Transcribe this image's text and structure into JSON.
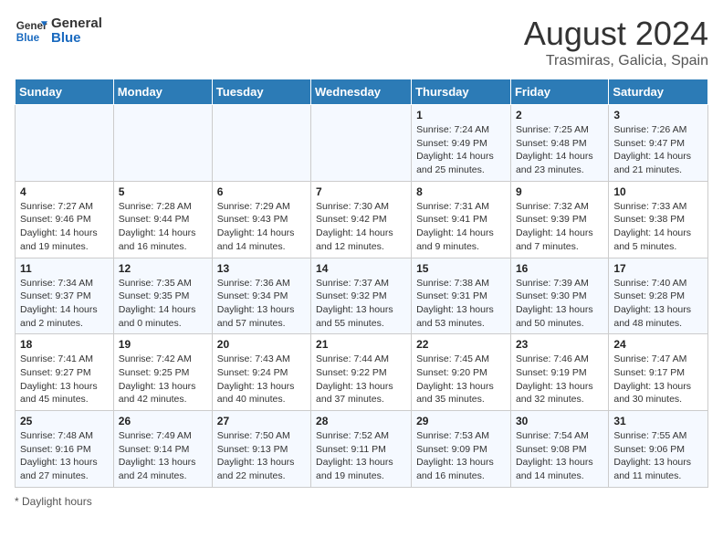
{
  "logo": {
    "line1": "General",
    "line2": "Blue"
  },
  "title": "August 2024",
  "subtitle": "Trasmiras, Galicia, Spain",
  "weekdays": [
    "Sunday",
    "Monday",
    "Tuesday",
    "Wednesday",
    "Thursday",
    "Friday",
    "Saturday"
  ],
  "weeks": [
    [
      {
        "day": "",
        "detail": ""
      },
      {
        "day": "",
        "detail": ""
      },
      {
        "day": "",
        "detail": ""
      },
      {
        "day": "",
        "detail": ""
      },
      {
        "day": "1",
        "detail": "Sunrise: 7:24 AM\nSunset: 9:49 PM\nDaylight: 14 hours and 25 minutes."
      },
      {
        "day": "2",
        "detail": "Sunrise: 7:25 AM\nSunset: 9:48 PM\nDaylight: 14 hours and 23 minutes."
      },
      {
        "day": "3",
        "detail": "Sunrise: 7:26 AM\nSunset: 9:47 PM\nDaylight: 14 hours and 21 minutes."
      }
    ],
    [
      {
        "day": "4",
        "detail": "Sunrise: 7:27 AM\nSunset: 9:46 PM\nDaylight: 14 hours and 19 minutes."
      },
      {
        "day": "5",
        "detail": "Sunrise: 7:28 AM\nSunset: 9:44 PM\nDaylight: 14 hours and 16 minutes."
      },
      {
        "day": "6",
        "detail": "Sunrise: 7:29 AM\nSunset: 9:43 PM\nDaylight: 14 hours and 14 minutes."
      },
      {
        "day": "7",
        "detail": "Sunrise: 7:30 AM\nSunset: 9:42 PM\nDaylight: 14 hours and 12 minutes."
      },
      {
        "day": "8",
        "detail": "Sunrise: 7:31 AM\nSunset: 9:41 PM\nDaylight: 14 hours and 9 minutes."
      },
      {
        "day": "9",
        "detail": "Sunrise: 7:32 AM\nSunset: 9:39 PM\nDaylight: 14 hours and 7 minutes."
      },
      {
        "day": "10",
        "detail": "Sunrise: 7:33 AM\nSunset: 9:38 PM\nDaylight: 14 hours and 5 minutes."
      }
    ],
    [
      {
        "day": "11",
        "detail": "Sunrise: 7:34 AM\nSunset: 9:37 PM\nDaylight: 14 hours and 2 minutes."
      },
      {
        "day": "12",
        "detail": "Sunrise: 7:35 AM\nSunset: 9:35 PM\nDaylight: 14 hours and 0 minutes."
      },
      {
        "day": "13",
        "detail": "Sunrise: 7:36 AM\nSunset: 9:34 PM\nDaylight: 13 hours and 57 minutes."
      },
      {
        "day": "14",
        "detail": "Sunrise: 7:37 AM\nSunset: 9:32 PM\nDaylight: 13 hours and 55 minutes."
      },
      {
        "day": "15",
        "detail": "Sunrise: 7:38 AM\nSunset: 9:31 PM\nDaylight: 13 hours and 53 minutes."
      },
      {
        "day": "16",
        "detail": "Sunrise: 7:39 AM\nSunset: 9:30 PM\nDaylight: 13 hours and 50 minutes."
      },
      {
        "day": "17",
        "detail": "Sunrise: 7:40 AM\nSunset: 9:28 PM\nDaylight: 13 hours and 48 minutes."
      }
    ],
    [
      {
        "day": "18",
        "detail": "Sunrise: 7:41 AM\nSunset: 9:27 PM\nDaylight: 13 hours and 45 minutes."
      },
      {
        "day": "19",
        "detail": "Sunrise: 7:42 AM\nSunset: 9:25 PM\nDaylight: 13 hours and 42 minutes."
      },
      {
        "day": "20",
        "detail": "Sunrise: 7:43 AM\nSunset: 9:24 PM\nDaylight: 13 hours and 40 minutes."
      },
      {
        "day": "21",
        "detail": "Sunrise: 7:44 AM\nSunset: 9:22 PM\nDaylight: 13 hours and 37 minutes."
      },
      {
        "day": "22",
        "detail": "Sunrise: 7:45 AM\nSunset: 9:20 PM\nDaylight: 13 hours and 35 minutes."
      },
      {
        "day": "23",
        "detail": "Sunrise: 7:46 AM\nSunset: 9:19 PM\nDaylight: 13 hours and 32 minutes."
      },
      {
        "day": "24",
        "detail": "Sunrise: 7:47 AM\nSunset: 9:17 PM\nDaylight: 13 hours and 30 minutes."
      }
    ],
    [
      {
        "day": "25",
        "detail": "Sunrise: 7:48 AM\nSunset: 9:16 PM\nDaylight: 13 hours and 27 minutes."
      },
      {
        "day": "26",
        "detail": "Sunrise: 7:49 AM\nSunset: 9:14 PM\nDaylight: 13 hours and 24 minutes."
      },
      {
        "day": "27",
        "detail": "Sunrise: 7:50 AM\nSunset: 9:13 PM\nDaylight: 13 hours and 22 minutes."
      },
      {
        "day": "28",
        "detail": "Sunrise: 7:52 AM\nSunset: 9:11 PM\nDaylight: 13 hours and 19 minutes."
      },
      {
        "day": "29",
        "detail": "Sunrise: 7:53 AM\nSunset: 9:09 PM\nDaylight: 13 hours and 16 minutes."
      },
      {
        "day": "30",
        "detail": "Sunrise: 7:54 AM\nSunset: 9:08 PM\nDaylight: 13 hours and 14 minutes."
      },
      {
        "day": "31",
        "detail": "Sunrise: 7:55 AM\nSunset: 9:06 PM\nDaylight: 13 hours and 11 minutes."
      }
    ]
  ],
  "footer": "Daylight hours"
}
